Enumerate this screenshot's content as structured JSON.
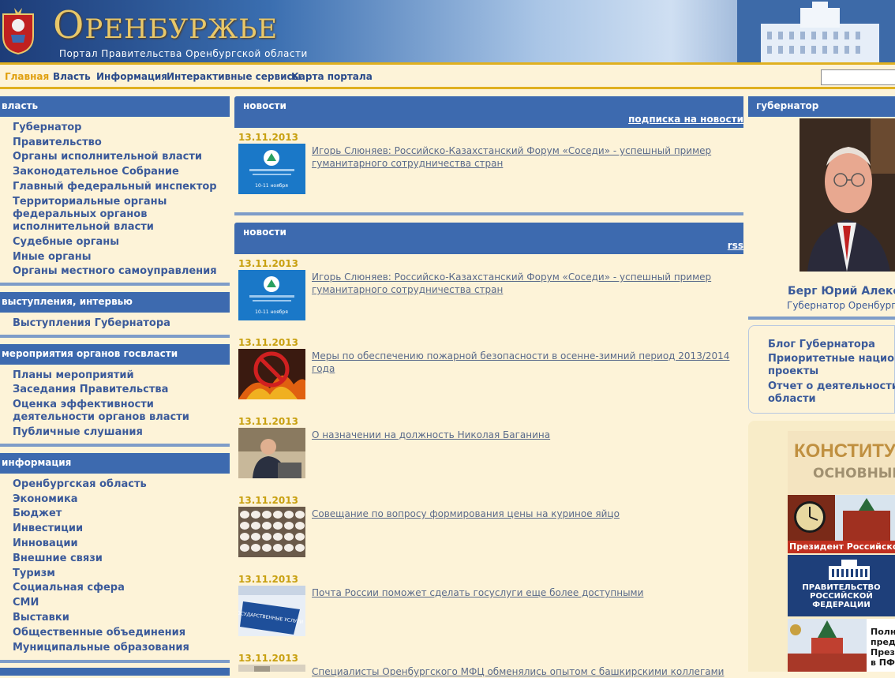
{
  "header": {
    "title": "Оренбуржье",
    "subtitle": "Портал Правительства Оренбургской области"
  },
  "nav": {
    "items": [
      {
        "label": "Главная",
        "active": true
      },
      {
        "label": "Власть"
      },
      {
        "label": "Информация"
      },
      {
        "label": "Интерактивные сервисы"
      },
      {
        "label": "Карта портала"
      }
    ],
    "search_value": ""
  },
  "left": {
    "sections": [
      {
        "title": "власть",
        "items": [
          "Губернатор",
          "Правительство",
          "Органы исполнительной власти",
          "Законодательное Собрание",
          "Главный федеральный инспектор",
          "Территориальные органы федеральных органов исполнительной власти",
          "Судебные органы",
          "Иные органы",
          "Органы местного самоуправления"
        ]
      },
      {
        "title": "выступления, интервью",
        "items": [
          "Выступления Губернатора"
        ]
      },
      {
        "title": "мероприятия органов госвласти",
        "items": [
          "Планы мероприятий",
          "Заседания Правительства",
          "Оценка эффективности деятельности органов власти",
          "Публичные слушания"
        ]
      },
      {
        "title": "информация",
        "items": [
          "Оренбургская область",
          "Экономика",
          "Бюджет",
          "Инвестиции",
          "Инновации",
          "Внешние связи",
          "Туризм",
          "Социальная сфера",
          "СМИ",
          "Выставки",
          "Общественные объединения",
          "Муниципальные образования"
        ]
      }
    ]
  },
  "news_top": {
    "title": "новости",
    "subscribe_label": "подписка на новости",
    "items": [
      {
        "date": "13.11.2013",
        "text": "Игорь Слюняев: Российско-Казахстанский Форум «Соседи» - успешный пример гуманитарного сотрудничества стран",
        "thumb": "forum"
      }
    ]
  },
  "news_main": {
    "title": "новости",
    "rss_label": "rss",
    "items": [
      {
        "date": "13.11.2013",
        "text": "Игорь Слюняев: Российско-Казахстанский Форум «Соседи» - успешный пример гуманитарного сотрудничества стран",
        "thumb": "forum"
      },
      {
        "date": "13.11.2013",
        "text": "Меры по обеспечению пожарной безопасности в осенне-зимний период 2013/2014 года",
        "thumb": "fire"
      },
      {
        "date": "13.11.2013",
        "text": "О назначении на должность Николая Баганина",
        "thumb": "person"
      },
      {
        "date": "13.11.2013",
        "text": "Совещание по вопросу формирования цены на куриное яйцо",
        "thumb": "eggs"
      },
      {
        "date": "13.11.2013",
        "text": "Почта России поможет сделать госуслуги еще более доступными",
        "thumb": "gosuslugi"
      },
      {
        "date": "13.11.2013",
        "text": "Специалисты Оренбургского МФЦ обменялись опытом с башкирскими коллегами",
        "thumb": "mfc"
      }
    ]
  },
  "governor": {
    "title": "губернатор",
    "name": "Берг Юрий Алекса",
    "position": "Губернатор Оренбургс",
    "links": [
      "Блог Губернатора",
      "Приоритетные национ проекты",
      "Отчет о деятельности области"
    ]
  },
  "banners": {
    "constitution_line1": "КОНСТИТУЦИ",
    "constitution_line2": "ОСНОВНЫЕ СТА",
    "president_label": "Президент Российской",
    "government_line1": "ПРАВИТЕЛЬСТВО",
    "government_line2": "РОССИЙСКОЙ",
    "government_line3": "ФЕДЕРАЦИИ",
    "pfr_lines": [
      "Полн",
      "пред",
      "Прези",
      "в ПФ"
    ]
  },
  "forum_thumb": {
    "text": "10-11 ноября"
  },
  "gos_thumb": {
    "text": "ГОСУДАРСТВЕННЫЕ УСЛУГИ"
  }
}
